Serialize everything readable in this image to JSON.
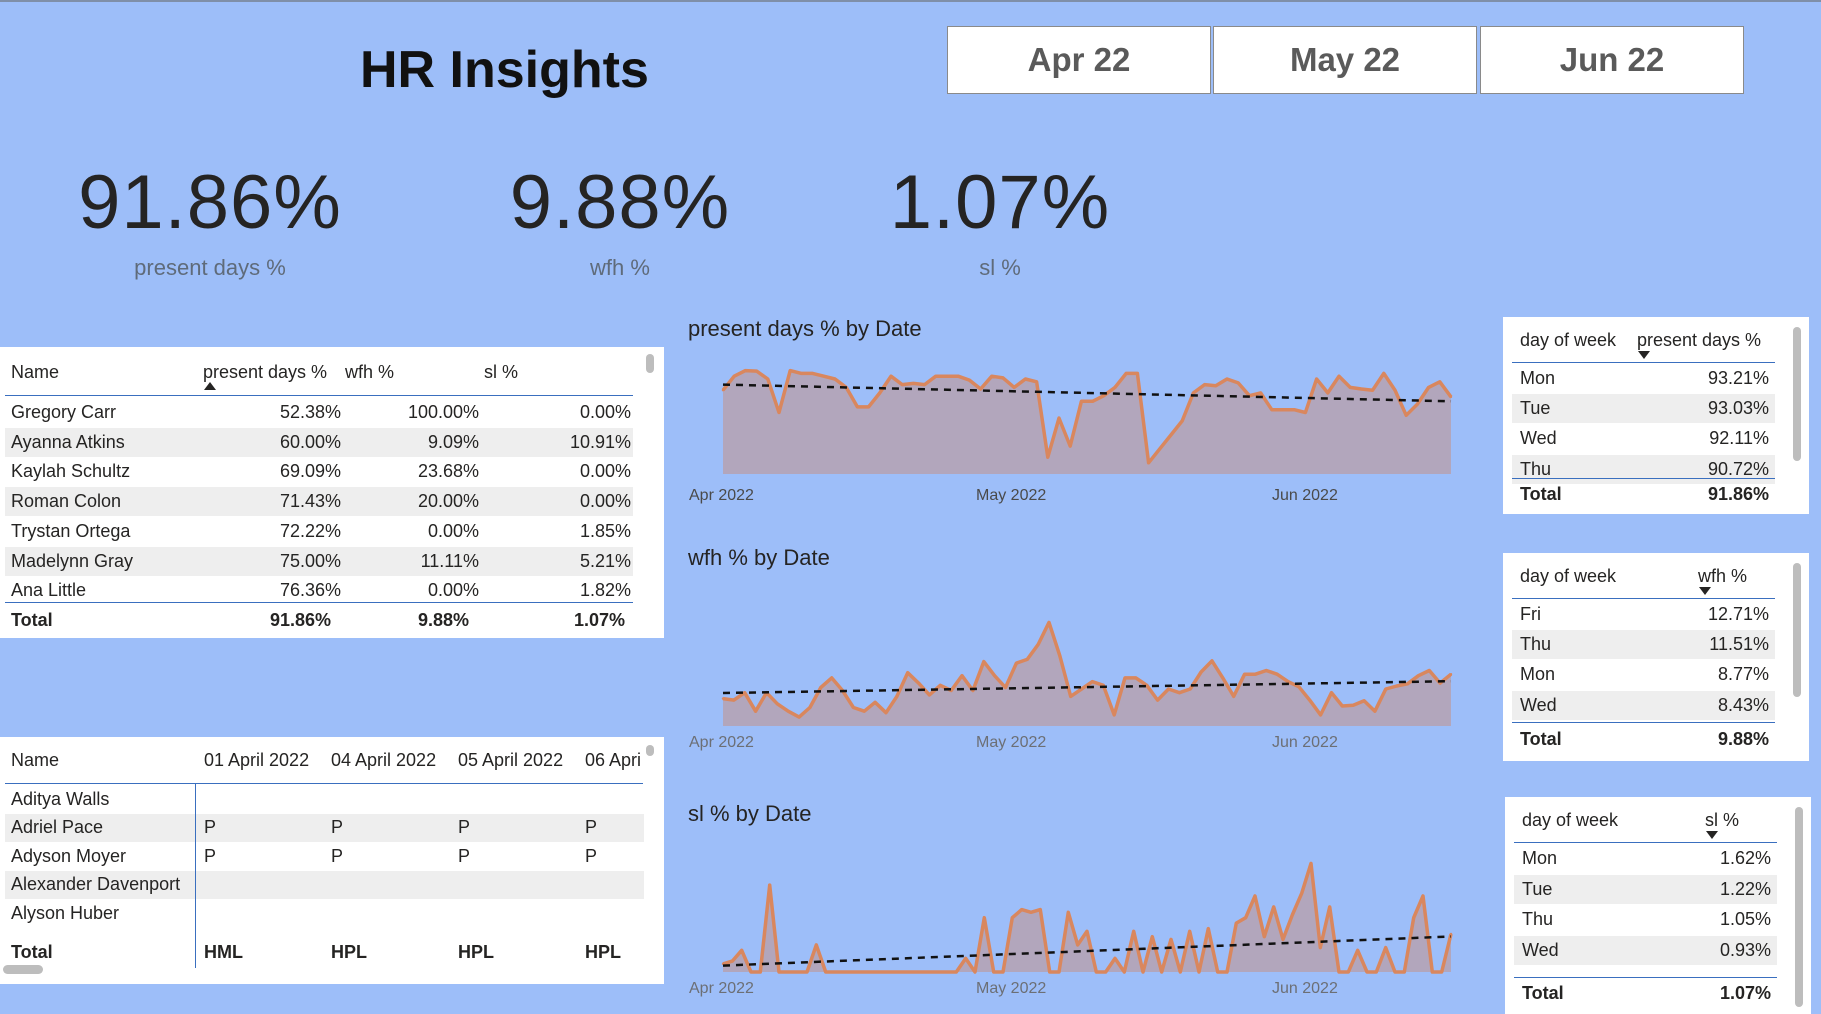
{
  "header": {
    "title": "HR Insights"
  },
  "slicers": [
    "Apr 22",
    "May 22",
    "Jun 22"
  ],
  "kpis": [
    {
      "value": "91.86%",
      "label": "present days %"
    },
    {
      "value": "9.88%",
      "label": "wfh %"
    },
    {
      "value": "1.07%",
      "label": "sl %"
    }
  ],
  "employee_table": {
    "columns": [
      "Name",
      "present days %",
      "wfh %",
      "sl %"
    ],
    "rows": [
      [
        "Gregory Carr",
        "52.38%",
        "100.00%",
        "0.00%"
      ],
      [
        "Ayanna Atkins",
        "60.00%",
        "9.09%",
        "10.91%"
      ],
      [
        "Kaylah Schultz",
        "69.09%",
        "23.68%",
        "0.00%"
      ],
      [
        "Roman Colon",
        "71.43%",
        "20.00%",
        "0.00%"
      ],
      [
        "Trystan Ortega",
        "72.22%",
        "0.00%",
        "1.85%"
      ],
      [
        "Madelynn Gray",
        "75.00%",
        "11.11%",
        "5.21%"
      ],
      [
        "Ana Little",
        "76.36%",
        "0.00%",
        "1.82%"
      ]
    ],
    "total": [
      "Total",
      "91.86%",
      "9.88%",
      "1.07%"
    ]
  },
  "attendance_matrix": {
    "columns": [
      "Name",
      "01 April 2022",
      "04 April 2022",
      "05 April 2022",
      "06 Apri"
    ],
    "rows": [
      [
        "Aditya Walls",
        "",
        "",
        "",
        ""
      ],
      [
        "Adriel Pace",
        "P",
        "P",
        "P",
        "P"
      ],
      [
        "Adyson Moyer",
        "P",
        "P",
        "P",
        "P"
      ],
      [
        "Alexander Davenport",
        "",
        "",
        "",
        ""
      ],
      [
        "Alyson Huber",
        "",
        "",
        "",
        ""
      ]
    ],
    "total": [
      "Total",
      "HML",
      "HPL",
      "HPL",
      "HPL"
    ]
  },
  "dow_tables": [
    {
      "columns": [
        "day of week",
        "present days %"
      ],
      "rows": [
        [
          "Mon",
          "93.21%"
        ],
        [
          "Tue",
          "93.03%"
        ],
        [
          "Wed",
          "92.11%"
        ],
        [
          "Thu",
          "90.72%"
        ]
      ],
      "total": [
        "Total",
        "91.86%"
      ]
    },
    {
      "columns": [
        "day of week",
        "wfh %"
      ],
      "rows": [
        [
          "Fri",
          "12.71%"
        ],
        [
          "Thu",
          "11.51%"
        ],
        [
          "Mon",
          "8.77%"
        ],
        [
          "Wed",
          "8.43%"
        ]
      ],
      "total": [
        "Total",
        "9.88%"
      ]
    },
    {
      "columns": [
        "day of week",
        "sl %"
      ],
      "rows": [
        [
          "Mon",
          "1.62%"
        ],
        [
          "Tue",
          "1.22%"
        ],
        [
          "Thu",
          "1.05%"
        ],
        [
          "Wed",
          "0.93%"
        ]
      ],
      "total": [
        "Total",
        "1.07%"
      ]
    }
  ],
  "colors": {
    "background": "#9DBEF9",
    "line": "#D9875E",
    "area": "#B3A4B8",
    "trend": "#111111"
  },
  "chart_data": [
    {
      "type": "area",
      "title": "present days % by Date",
      "x_tick_labels": [
        "Apr 2022",
        "May 2022",
        "Jun 2022"
      ],
      "trendline": true,
      "y": [
        0.91,
        0.935,
        0.945,
        0.944,
        0.93,
        0.87,
        0.945,
        0.94,
        0.94,
        0.935,
        0.93,
        0.915,
        0.88,
        0.88,
        0.905,
        0.935,
        0.92,
        0.922,
        0.92,
        0.935,
        0.935,
        0.935,
        0.928,
        0.912,
        0.935,
        0.932,
        0.915,
        0.93,
        0.925,
        0.79,
        0.86,
        0.81,
        0.89,
        0.89,
        0.9,
        0.915,
        0.94,
        0.94,
        0.78,
        0.805,
        0.83,
        0.855,
        0.905,
        0.92,
        0.918,
        0.93,
        0.923,
        0.9,
        0.905,
        0.875,
        0.875,
        0.875,
        0.87,
        0.93,
        0.905,
        0.935,
        0.915,
        0.912,
        0.91,
        0.94,
        0.91,
        0.865,
        0.885,
        0.915,
        0.925,
        0.898
      ]
    },
    {
      "type": "area",
      "title": "wfh % by Date",
      "x_tick_labels": [
        "Apr 2022",
        "May 2022",
        "Jun 2022"
      ],
      "trendline": true,
      "y": [
        0.097,
        0.095,
        0.105,
        0.08,
        0.105,
        0.09,
        0.08,
        0.072,
        0.085,
        0.112,
        0.125,
        0.108,
        0.085,
        0.08,
        0.092,
        0.078,
        0.1,
        0.132,
        0.118,
        0.102,
        0.115,
        0.108,
        0.128,
        0.108,
        0.147,
        0.128,
        0.112,
        0.145,
        0.15,
        0.17,
        0.2,
        0.155,
        0.1,
        0.11,
        0.12,
        0.115,
        0.075,
        0.125,
        0.125,
        0.115,
        0.095,
        0.11,
        0.105,
        0.11,
        0.133,
        0.148,
        0.125,
        0.1,
        0.13,
        0.13,
        0.135,
        0.13,
        0.12,
        0.113,
        0.095,
        0.075,
        0.105,
        0.087,
        0.088,
        0.094,
        0.08,
        0.11,
        0.114,
        0.117,
        0.128,
        0.135,
        0.118,
        0.13
      ]
    },
    {
      "type": "area",
      "title": "sl % by Date",
      "x_tick_labels": [
        "Apr 2022",
        "May 2022",
        "Jun 2022"
      ],
      "trendline": true,
      "y": [
        0.003,
        0.004,
        0.008,
        0.0,
        0.0,
        0.032,
        0.0,
        0.0,
        0.0,
        0.0,
        0.01,
        0.0,
        0.0,
        0.0,
        0.0,
        0.0,
        0.0,
        0.0,
        0.0,
        0.0,
        0.0,
        0.0,
        0.0,
        0.0,
        0.0,
        0.0,
        0.005,
        0.0,
        0.02,
        0.0,
        0.0,
        0.02,
        0.023,
        0.022,
        0.023,
        0.0,
        0.0,
        0.022,
        0.01,
        0.015,
        0.0,
        0.0,
        0.005,
        0.0,
        0.015,
        0.0,
        0.013,
        0.0,
        0.012,
        0.0,
        0.015,
        0.0,
        0.016,
        0.0,
        0.0,
        0.018,
        0.02,
        0.028,
        0.013,
        0.024,
        0.012,
        0.021,
        0.029,
        0.04,
        0.009,
        0.024,
        0.0,
        0.0,
        0.008,
        0.0,
        0.0,
        0.009,
        0.0,
        0.0,
        0.02,
        0.028,
        0.0,
        0.0,
        0.014
      ]
    }
  ]
}
